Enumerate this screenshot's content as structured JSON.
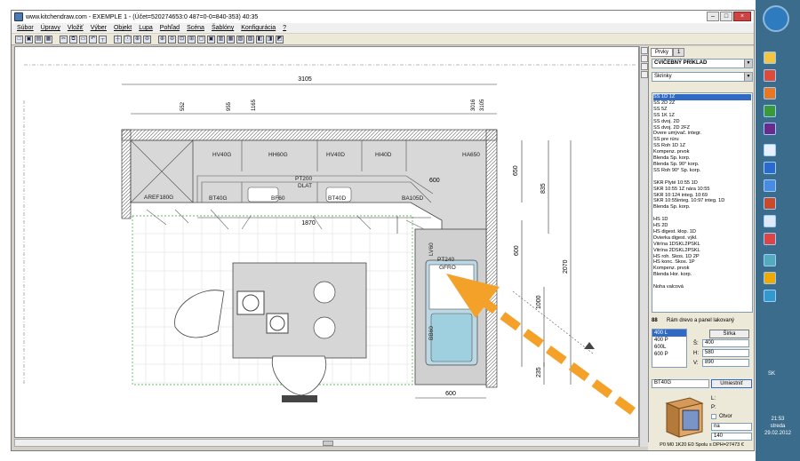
{
  "window": {
    "title": "www.kitchendraw.com - EXEMPLE 1 - (Účet=520274653:0 487=0-0=840-353) 40:35"
  },
  "menu": [
    "Súbor",
    "Úpravy",
    "Vložiť",
    "Výber",
    "Objekt",
    "Lupa",
    "Pohľad",
    "Scéna",
    "Šablóny",
    "Konfigurácia",
    "?"
  ],
  "drawing": {
    "dims": {
      "top": "3105",
      "top_a": "552",
      "top_b": "955",
      "top_c": "1165",
      "right_a": "3016",
      "right_b": "3105",
      "mid": "1870",
      "r1": "650",
      "r2": "835",
      "r3": "600",
      "r4": "2070",
      "r5": "1000",
      "r6": "235",
      "bottom": "600",
      "right_depth": "600"
    },
    "labels": {
      "aref": "AREF180G",
      "hv40g": "HV40G",
      "hh60g": "HH60G",
      "hv40d": "HV40D",
      "hi40": "HI40D",
      "ha60": "HA650",
      "pt200": "PT200",
      "dlat": "DLAT",
      "bt40g": "BT40G",
      "bf60": "BF60",
      "bt40d": "BT40D",
      "ba105": "BA105D",
      "pt240": "PT240",
      "gfro": "GFRO",
      "bb60": "BB60",
      "lv60": "LV60"
    }
  },
  "panel": {
    "tabs": [
      "Prvky",
      "1"
    ],
    "catalog": "CVIČEBNÝ PRÍKLAD",
    "category": "Skrinky",
    "items": [
      "SS 1D 1Z",
      "SS 2D 2Z",
      "SS 5Z",
      "SS 1K 1Z",
      "SS dvoj. 2D",
      "SS dvoj. 2D 2FZ",
      "Dvere umývač. integr.",
      "SS pre rúru",
      "SS Roh 1D 1Z",
      "Kompenz. prvok",
      "Blenda Sp. korp.",
      "Blenda Sp. 90° korp.",
      "SS Roh 90° Sp. korp.",
      "",
      "SKR Plyté 10:55 1D",
      "SKR 10:55 1Z nára 10:55",
      "SKR 10:124 integ. 10:69",
      "SKR 10:55integ. 10:97 integ. 1D",
      "Blenda Sp. korp.",
      "",
      "HS 1D",
      "HS 2D",
      "HS digest. klop. 1D",
      "Dvierka digest. výkl.",
      "Vitrína 1DSKL2PSKL",
      "Vitrína 2DSKL2PSKL",
      "HS roh. Skos. 1D 2P",
      "HS konc. Skos. 1P",
      "Kompenz. prvok",
      "Blenda Hor. korp.",
      "",
      "Noha valcová"
    ],
    "selected_item": 0,
    "finish_label": "Rám drevo a panel lakovaný",
    "finish_code": "88",
    "variants": [
      "400 L",
      "400 P",
      "600L",
      "600 P"
    ],
    "width_btn": "Šírka",
    "s_label": "Š:",
    "s_val": "400",
    "h_label": "H:",
    "h_val": "580",
    "v_label": "V:",
    "v_val": "890",
    "code": "BT40G",
    "place_btn": "Umiestniť",
    "l_label": "L:",
    "p_label": "P:",
    "ck_label": "Otvor",
    "combo_na": "na",
    "combo_140": "140",
    "status": "P0 M0 1K20 E0 Spolu s DPH=27473 €"
  },
  "tray": {
    "lang": "SK",
    "time": "21:53",
    "day": "streda",
    "date": "29.02.2012"
  },
  "colors": {
    "arrow": "#f4a12a",
    "selection": "#316ac5",
    "titlebar": "#ffffff"
  }
}
